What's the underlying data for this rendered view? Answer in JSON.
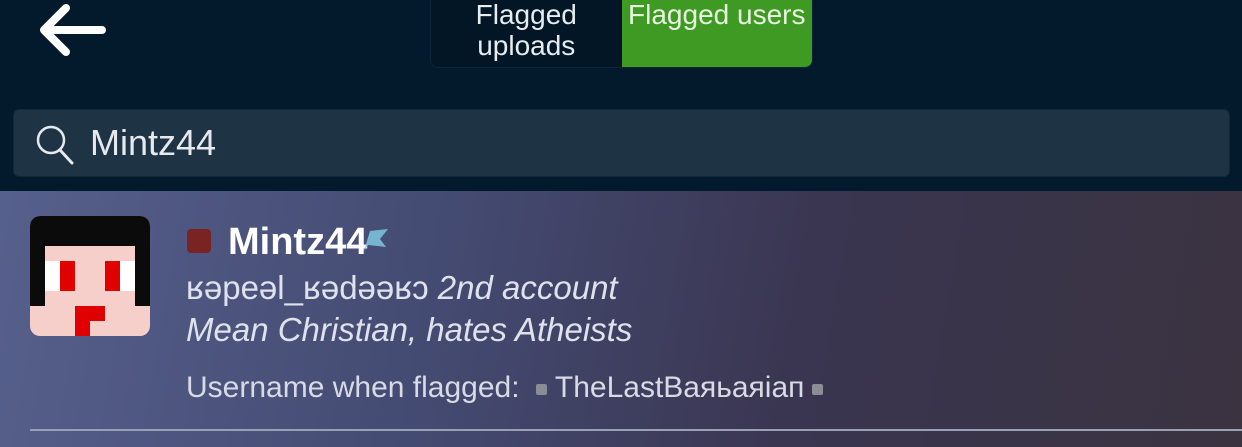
{
  "header": {
    "back_icon": "arrow-left-icon",
    "tabs": [
      {
        "label": "Flagged uploads",
        "active": false
      },
      {
        "label": "Flagged users",
        "active": true
      }
    ],
    "accent": "#3f9a24"
  },
  "search": {
    "icon": "search-icon",
    "value": "Mintz44"
  },
  "results": [
    {
      "name": "Mintz44",
      "status_color": "#7a2323",
      "alt_name": "ʁəpeəl_ʁədəəʁɔ",
      "alt_suffix": " 2nd account",
      "note": "Mean Christian, hates Atheists",
      "flagged_label": "Username when flagged:",
      "flagged_username": "TheLastBaяьaяiaп"
    }
  ]
}
